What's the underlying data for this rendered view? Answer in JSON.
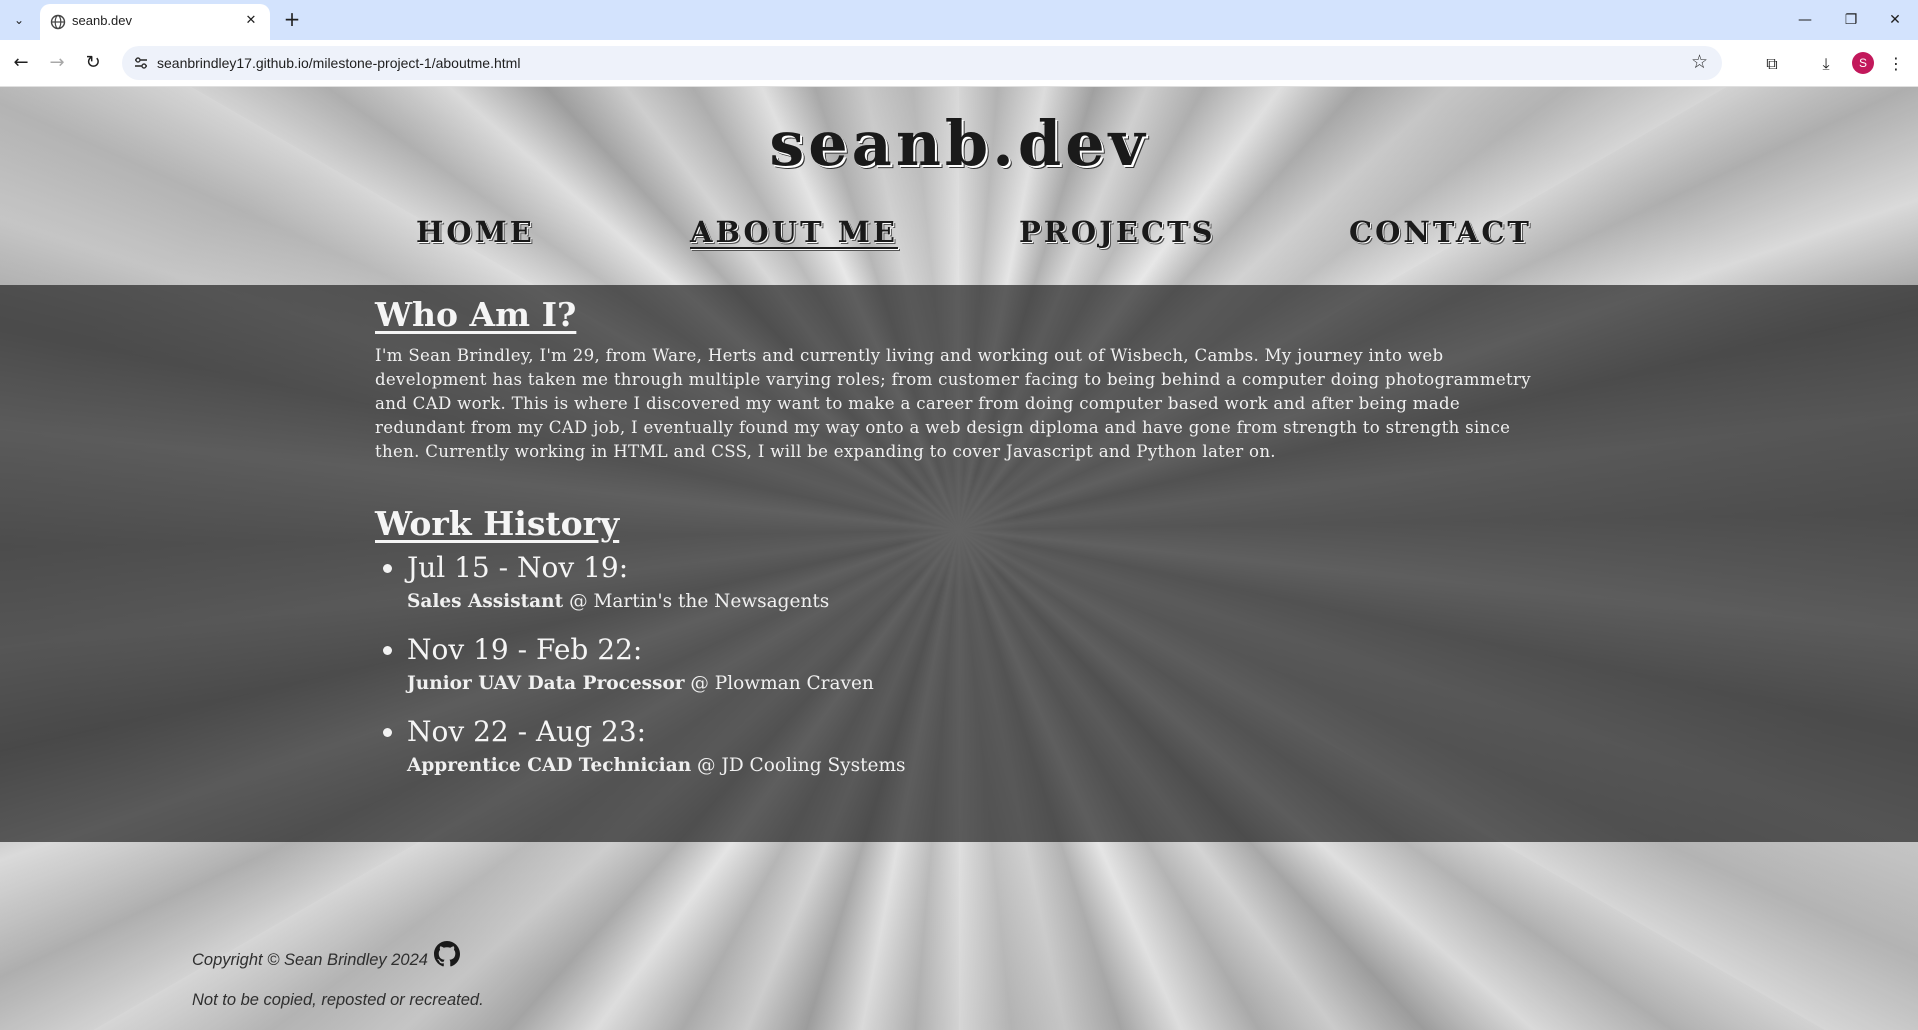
{
  "browser": {
    "tab_title": "seanb.dev",
    "url": "seanbrindley17.github.io/milestone-project-1/aboutme.html",
    "profile_initial": "S"
  },
  "site": {
    "title": "seanb.dev",
    "nav": [
      {
        "label": "HOME"
      },
      {
        "label": "ABOUT ME",
        "active": true
      },
      {
        "label": "PROJECTS"
      },
      {
        "label": "CONTACT"
      }
    ]
  },
  "about": {
    "heading": "Who Am I?",
    "text": "I'm Sean Brindley, I'm 29, from Ware, Herts and currently living and working out of Wisbech, Cambs. My journey into web development has taken me through multiple varying roles; from customer facing to being behind a computer doing photogrammetry and CAD work. This is where I discovered my want to make a career from doing computer based work and after being made redundant from my CAD job, I eventually found my way onto a web design diploma and have gone from strength to strength since then. Currently working in HTML and CSS, I will be expanding to cover Javascript and Python later on."
  },
  "work": {
    "heading": "Work History",
    "items": [
      {
        "period": "Jul 15 - Nov 19:",
        "role": "Sales Assistant",
        "employer": "@ Martin's the Newsagents"
      },
      {
        "period": "Nov 19 - Feb 22:",
        "role": "Junior UAV Data Processor",
        "employer": "@ Plowman Craven"
      },
      {
        "period": "Nov 22 - Aug 23:",
        "role": "Apprentice CAD Technician",
        "employer": "@ JD Cooling Systems"
      }
    ]
  },
  "footer": {
    "copyright": "Copyright © Sean Brindley 2024",
    "note": "Not to be copied, reposted or recreated.",
    "github_icon": "github-icon"
  }
}
